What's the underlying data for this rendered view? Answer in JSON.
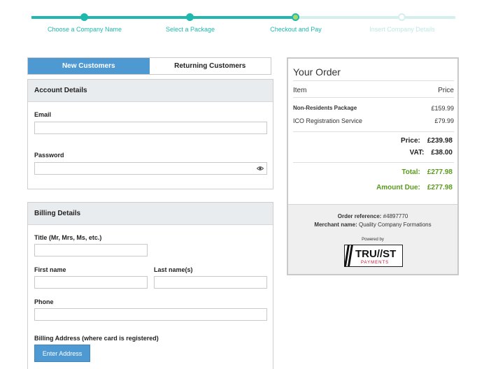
{
  "progress": {
    "steps": [
      {
        "label": "Choose a Company Name",
        "state": "done"
      },
      {
        "label": "Select a Package",
        "state": "done"
      },
      {
        "label": "Checkout and Pay",
        "state": "current"
      },
      {
        "label": "Insert Company Details",
        "state": "todo"
      }
    ]
  },
  "tabs": {
    "new": "New Customers",
    "returning": "Returning Customers"
  },
  "account": {
    "title": "Account Details",
    "email_label": "Email",
    "email_value": "",
    "password_label": "Password",
    "password_value": ""
  },
  "billing": {
    "title": "Billing Details",
    "title_field_label": "Title (Mr, Mrs, Ms, etc.)",
    "first_name_label": "First name",
    "last_name_label": "Last name(s)",
    "phone_label": "Phone",
    "address_label": "Billing Address (where card is registered)",
    "enter_address_button": "Enter Address"
  },
  "order": {
    "title": "Your Order",
    "col_item": "Item",
    "col_price": "Price",
    "items": [
      {
        "name": "Non-Residents Package",
        "price": "£159.99",
        "bold": true
      },
      {
        "name": "ICO Registration Service",
        "price": "£79.99",
        "bold": false
      }
    ],
    "price_label": "Price:",
    "price_value": "£239.98",
    "vat_label": "VAT:",
    "vat_value": "£38.00",
    "total_label": "Total:",
    "total_value": "£277.98",
    "amount_due_label": "Amount Due:",
    "amount_due_value": "£277.98",
    "order_ref_label": "Order reference:",
    "order_ref_value": "#4897770",
    "merchant_label": "Merchant name:",
    "merchant_value": "Quality Company Formations",
    "powered_by": "Powered by",
    "logo_text_main": "TRU//ST",
    "logo_text_sub": "PAYMENTS"
  },
  "colors": {
    "accent": "#1fb8ae",
    "button": "#4f99d3",
    "green_total": "#5a9a1c",
    "logo_red": "#c8102e"
  },
  "icons": {
    "password_toggle": "eye-icon"
  }
}
